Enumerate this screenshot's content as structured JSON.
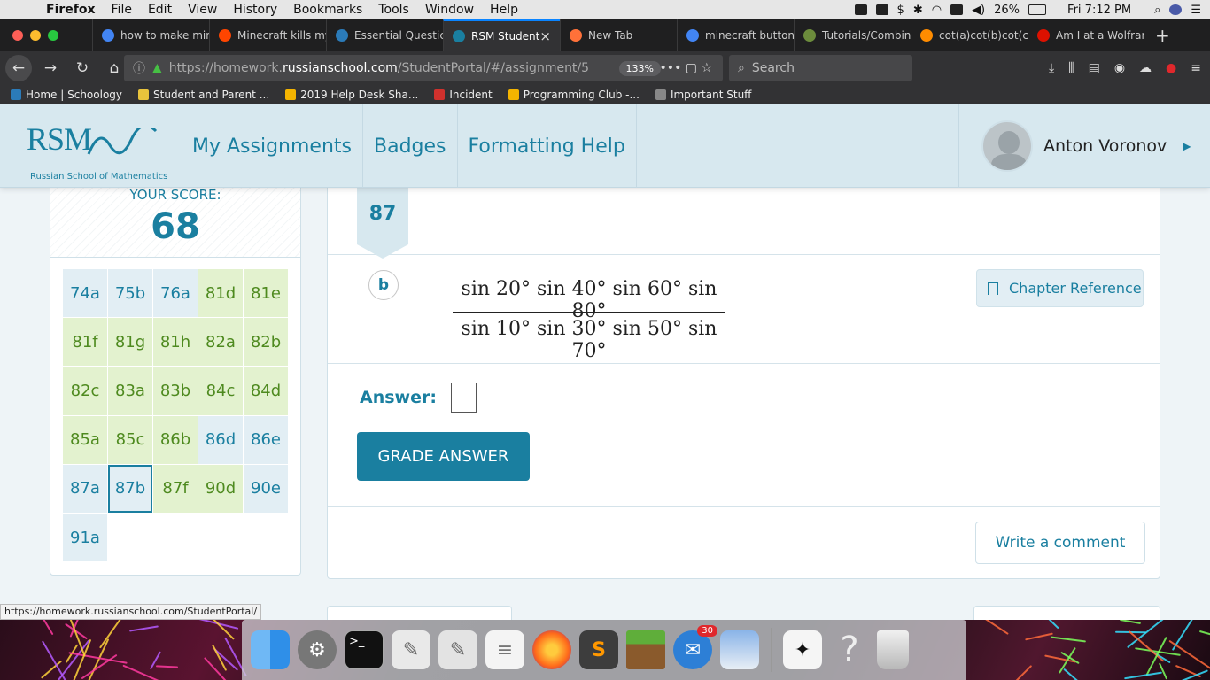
{
  "menubar": {
    "app": "Firefox",
    "items": [
      "File",
      "Edit",
      "View",
      "History",
      "Bookmarks",
      "Tools",
      "Window",
      "Help"
    ],
    "battery": "26%",
    "clock": "Fri 7:12 PM"
  },
  "tabs": [
    {
      "label": "how to make min",
      "color": "#4285f4"
    },
    {
      "label": "Minecraft kills my",
      "color": "#ff4500"
    },
    {
      "label": "Essential Questic",
      "color": "#2b7bb9"
    },
    {
      "label": "RSM Student",
      "color": "#1a7fa0",
      "active": true
    },
    {
      "label": "New Tab",
      "color": "#ff7139"
    },
    {
      "label": "minecraft button",
      "color": "#4285f4"
    },
    {
      "label": "Tutorials/Combin",
      "color": "#6c8c3c"
    },
    {
      "label": "cot(a)cot(b)cot(c",
      "color": "#ff8c00"
    },
    {
      "label": "Am I at a Wolfram",
      "color": "#dd1100"
    }
  ],
  "navbar": {
    "url_prefix": "https://homework.",
    "url_domain": "russianschool.com",
    "url_suffix": "/StudentPortal/#/assignment/5",
    "zoom": "133%",
    "search_placeholder": "Search"
  },
  "bookmarks": [
    {
      "label": "Home | Schoology",
      "color": "#2b7bb9"
    },
    {
      "label": "Student and Parent ...",
      "color": "#e8c33c"
    },
    {
      "label": "2019 Help Desk Sha...",
      "color": "#f4b400"
    },
    {
      "label": "Incident",
      "color": "#d0312d"
    },
    {
      "label": "Programming Club -...",
      "color": "#f4b400"
    },
    {
      "label": "Important Stuff",
      "color": "#888888"
    }
  ],
  "header": {
    "logo": "RSM",
    "logo_sub": "Russian School of Mathematics",
    "nav": [
      "My Assignments",
      "Badges",
      "Formatting Help"
    ],
    "user": "Anton Voronov"
  },
  "score": {
    "label": "YOUR SCORE:",
    "value": "68"
  },
  "problems": [
    {
      "label": "74a",
      "s": 0
    },
    {
      "label": "75b",
      "s": 0
    },
    {
      "label": "76a",
      "s": 0
    },
    {
      "label": "81d",
      "s": 1
    },
    {
      "label": "81e",
      "s": 1
    },
    {
      "label": "81f",
      "s": 1
    },
    {
      "label": "81g",
      "s": 1
    },
    {
      "label": "81h",
      "s": 1
    },
    {
      "label": "82a",
      "s": 1
    },
    {
      "label": "82b",
      "s": 1
    },
    {
      "label": "82c",
      "s": 1
    },
    {
      "label": "83a",
      "s": 1
    },
    {
      "label": "83b",
      "s": 1
    },
    {
      "label": "84c",
      "s": 1
    },
    {
      "label": "84d",
      "s": 1
    },
    {
      "label": "85a",
      "s": 1
    },
    {
      "label": "85c",
      "s": 1
    },
    {
      "label": "86b",
      "s": 1
    },
    {
      "label": "86d",
      "s": 0
    },
    {
      "label": "86e",
      "s": 0
    },
    {
      "label": "87a",
      "s": 0
    },
    {
      "label": "87b",
      "s": 0,
      "selected": true
    },
    {
      "label": "87f",
      "s": 1
    },
    {
      "label": "90d",
      "s": 1
    },
    {
      "label": "90e",
      "s": 0
    },
    {
      "label": "91a",
      "s": 0
    }
  ],
  "question": {
    "number": "87",
    "part": "b",
    "numerator": "sin 20° sin 40° sin 60° sin 80°",
    "denominator": "sin 10° sin 30° sin 50° sin 70°",
    "chapter_ref": "Chapter Reference",
    "answer_label": "Answer:",
    "answer_value": "",
    "grade_button": "GRADE ANSWER",
    "comment_button": "Write a comment"
  },
  "status_url": "https://homework.russianschool.com/StudentPortal/",
  "dock": {
    "mail_badge": "30"
  }
}
